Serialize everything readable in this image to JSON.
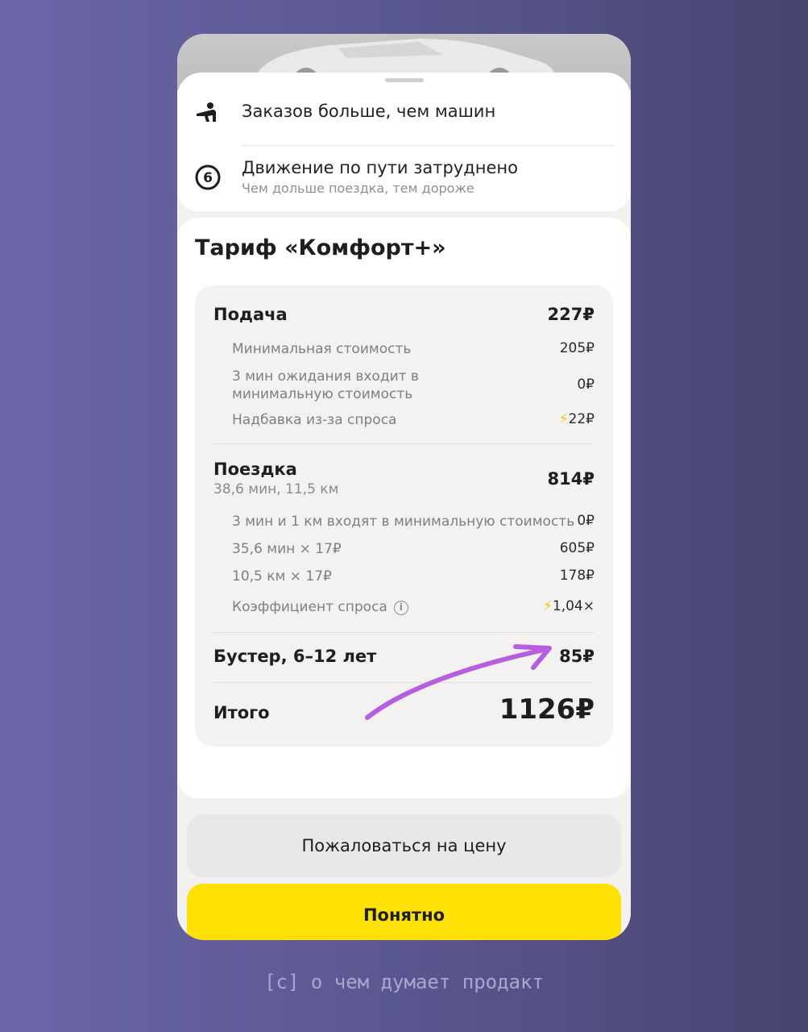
{
  "notices": [
    {
      "title": "Заказов больше, чем машин",
      "subtitle": "",
      "icon": "person-hailing-icon"
    },
    {
      "title": "Движение по пути затруднено",
      "subtitle": "Чем дольше поездка, тем дороже",
      "icon": "traffic-score-icon",
      "icon_text": "6"
    }
  ],
  "tariff": {
    "title": "Тариф «Комфорт+»",
    "pickup": {
      "label": "Подача",
      "value": "227₽",
      "items": [
        {
          "label": "Минимальная стоимость",
          "value": "205₽"
        },
        {
          "label_line1": "3 мин ожидания входит в",
          "label_line2": "минимальную стоимость",
          "value": "0₽"
        },
        {
          "label": "Надбавка из-за спроса",
          "value": "22₽",
          "icon": "lightning-icon"
        }
      ]
    },
    "ride": {
      "label": "Поездка",
      "details": "38,6 мин, 11,5 км",
      "value": "814₽",
      "items": [
        {
          "label": "3 мин и 1 км входят в минимальную стоимость",
          "value": "0₽"
        },
        {
          "label": "35,6 мин × 17₽",
          "value": "605₽"
        },
        {
          "label": "10,5 км × 17₽",
          "value": "178₽"
        },
        {
          "label": "Коэффициент спроса",
          "value": "1,04×",
          "icon": "lightning-icon",
          "info_icon": "info-icon",
          "info_glyph": "i"
        }
      ]
    },
    "booster": {
      "label": "Бустер, 6–12 лет",
      "value": "85₽"
    },
    "total": {
      "label": "Итого",
      "value": "1126₽"
    }
  },
  "buttons": {
    "complain": "Пожаловаться на цену",
    "ok": "Понятно"
  },
  "watermark": "[c] о чем думает продакт",
  "colors": {
    "accent_yellow": "#fde004",
    "bolt": "#f6c21a",
    "arrow": "#b75ee0",
    "background": "#5a5790"
  }
}
